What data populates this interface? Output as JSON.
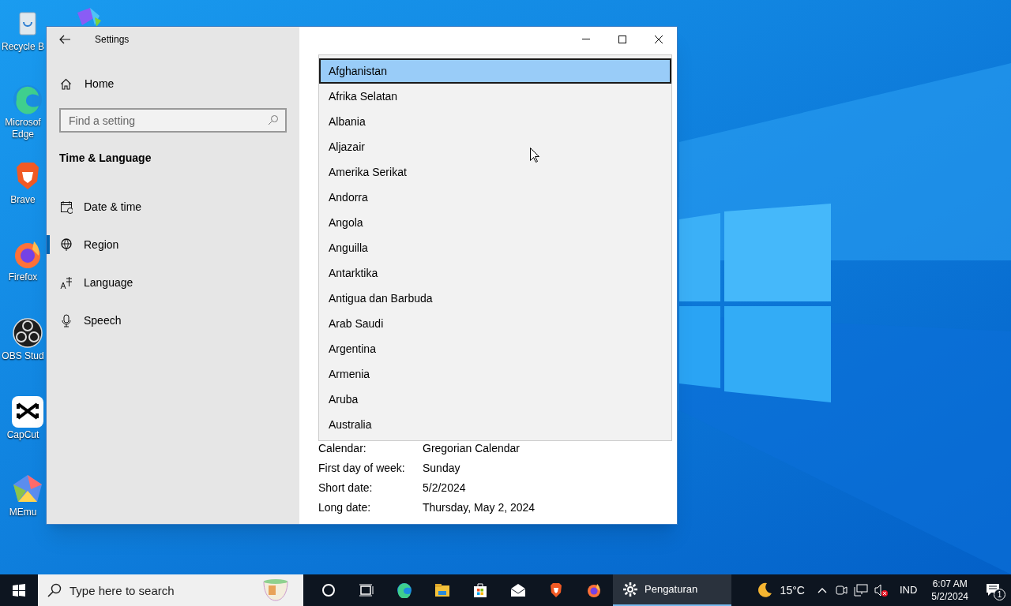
{
  "desktop_icons": [
    {
      "label": "Recycle B",
      "kind": "recycle"
    },
    {
      "kind": "covered"
    },
    {
      "label": "Microsof\nEdge",
      "kind": "edge"
    },
    {
      "label": "Brave",
      "kind": "brave"
    },
    {
      "label": "Firefox",
      "kind": "firefox"
    },
    {
      "label": "OBS Stud",
      "kind": "obs"
    },
    {
      "label": "CapCut",
      "kind": "capcut"
    },
    {
      "label": "MEmu",
      "kind": "memu"
    }
  ],
  "window": {
    "title": "Settings",
    "home": "Home",
    "search": {
      "placeholder": "Find a setting"
    },
    "section": "Time & Language",
    "nav": [
      {
        "label": "Date & time",
        "kind": "calendar",
        "selected": false
      },
      {
        "label": "Region",
        "kind": "globe",
        "selected": true
      },
      {
        "label": "Language",
        "kind": "language",
        "selected": false
      },
      {
        "label": "Speech",
        "kind": "mic",
        "selected": false
      }
    ],
    "country_list": [
      {
        "label": "Afghanistan",
        "selected": true
      },
      {
        "label": "Afrika Selatan",
        "selected": false
      },
      {
        "label": "Albania",
        "selected": false
      },
      {
        "label": "Aljazair",
        "selected": false
      },
      {
        "label": "Amerika Serikat",
        "selected": false
      },
      {
        "label": "Andorra",
        "selected": false
      },
      {
        "label": "Angola",
        "selected": false
      },
      {
        "label": "Anguilla",
        "selected": false
      },
      {
        "label": "Antarktika",
        "selected": false
      },
      {
        "label": "Antigua dan Barbuda",
        "selected": false
      },
      {
        "label": "Arab Saudi",
        "selected": false
      },
      {
        "label": "Argentina",
        "selected": false
      },
      {
        "label": "Armenia",
        "selected": false
      },
      {
        "label": "Aruba",
        "selected": false
      },
      {
        "label": "Australia",
        "selected": false
      }
    ],
    "format_details": [
      {
        "label": "Calendar:",
        "value": "Gregorian Calendar"
      },
      {
        "label": "First day of week:",
        "value": "Sunday"
      },
      {
        "label": "Short date:",
        "value": "5/2/2024"
      },
      {
        "label": "Long date:",
        "value": "Thursday, May 2, 2024"
      }
    ]
  },
  "taskbar": {
    "search": {
      "placeholder": "Type here to search"
    },
    "apps": [
      {
        "kind": "cortana"
      },
      {
        "kind": "taskview"
      },
      {
        "kind": "edge"
      },
      {
        "kind": "explorer"
      },
      {
        "kind": "store"
      },
      {
        "kind": "mail"
      },
      {
        "kind": "brave"
      },
      {
        "kind": "firefox"
      },
      {
        "kind": "settings",
        "label": "Pengaturan",
        "selected": true
      }
    ],
    "weather": "15°C",
    "language": "IND",
    "time": "6:07 AM",
    "date": "5/2/2024",
    "notifications": "1"
  }
}
